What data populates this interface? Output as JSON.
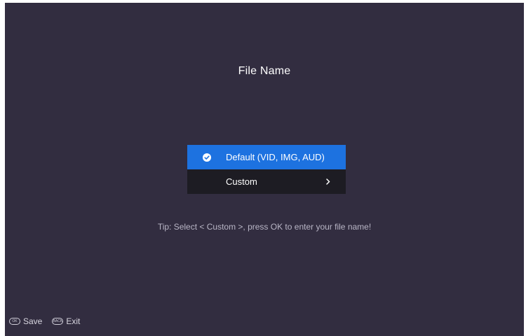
{
  "dialog": {
    "title": "File Name",
    "options": [
      {
        "label": "Default (VID, IMG, AUD)",
        "selected": true,
        "icon": "check-circle-icon"
      },
      {
        "label": "Custom",
        "selected": false,
        "icon": "chevron-right-icon"
      }
    ],
    "tip": "Tip: Select < Custom >, press OK to enter your file name!"
  },
  "footer": {
    "save": {
      "key": "OK",
      "label": "Save"
    },
    "exit": {
      "key": "BACK",
      "label": "Exit"
    }
  },
  "colors": {
    "background": "#322d40",
    "selected": "#1d72e0",
    "item": "#1d1c23",
    "text": "#ffffff",
    "tip": "#b9b6c6"
  }
}
